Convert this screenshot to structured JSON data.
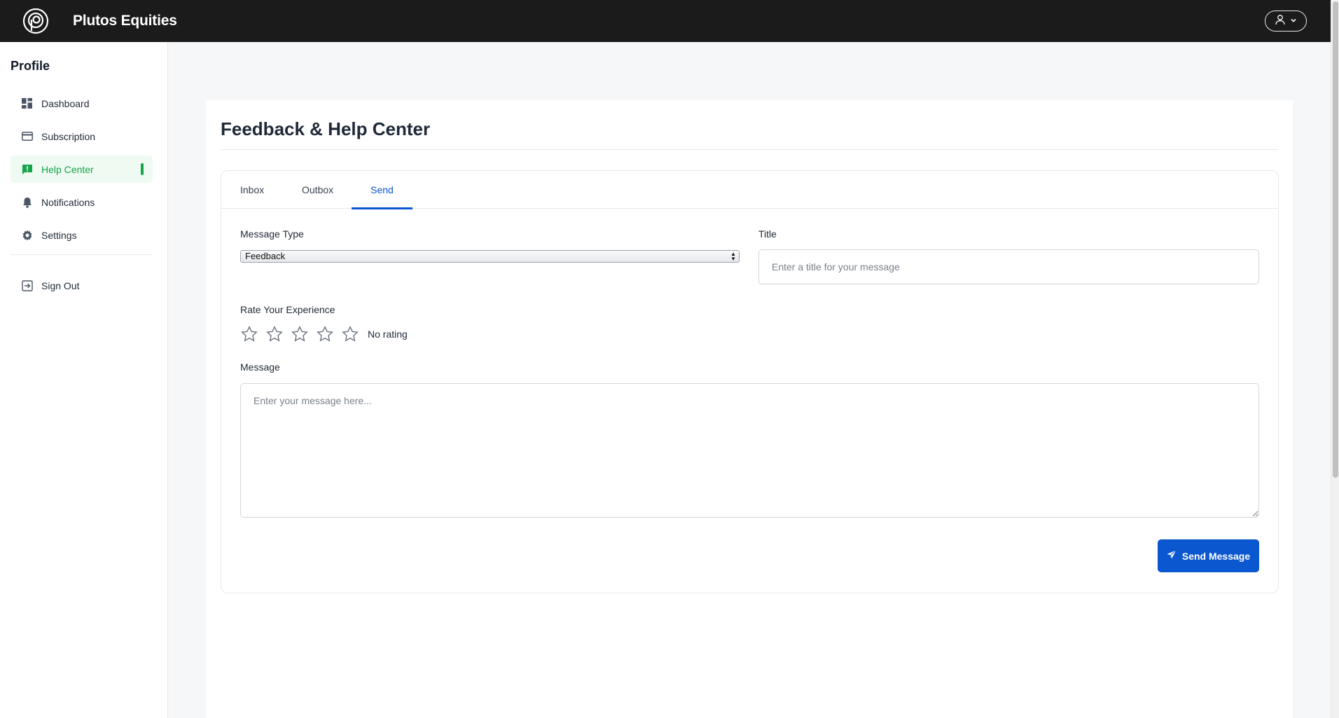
{
  "app": {
    "brand": "Plutos Equities"
  },
  "sidebar": {
    "title": "Profile",
    "items": [
      {
        "label": "Dashboard",
        "icon": "dashboard-icon",
        "active": false
      },
      {
        "label": "Subscription",
        "icon": "credit-card-icon",
        "active": false
      },
      {
        "label": "Help Center",
        "icon": "chat-alert-icon",
        "active": true
      },
      {
        "label": "Notifications",
        "icon": "bell-icon",
        "active": false
      },
      {
        "label": "Settings",
        "icon": "gear-icon",
        "active": false
      }
    ],
    "sign_out": {
      "label": "Sign Out",
      "icon": "sign-out-icon"
    }
  },
  "main": {
    "title": "Feedback & Help Center",
    "tabs": [
      {
        "label": "Inbox",
        "active": false
      },
      {
        "label": "Outbox",
        "active": false
      },
      {
        "label": "Send",
        "active": true
      }
    ],
    "form": {
      "message_type_label": "Message Type",
      "message_type_value": "Feedback",
      "title_label": "Title",
      "title_placeholder": "Enter a title for your message",
      "rating_label": "Rate Your Experience",
      "rating_value": 0,
      "rating_max": 5,
      "rating_text": "No rating",
      "message_label": "Message",
      "message_placeholder": "Enter your message here...",
      "send_label": "Send Message"
    }
  },
  "colors": {
    "topbar": "#1b1b1b",
    "accent_green": "#16a34a",
    "accent_blue": "#0b57d0"
  }
}
